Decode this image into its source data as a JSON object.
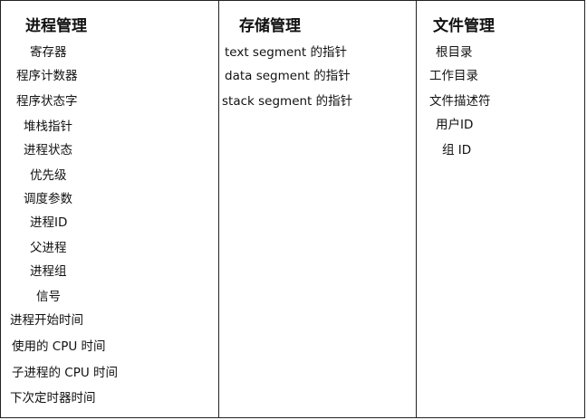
{
  "columns": [
    {
      "header": "进程管理",
      "items": [
        "寄存器",
        "程序计数器",
        "程序状态字",
        "堆栈指针",
        "进程状态",
        "优先级",
        "调度参数",
        "进程ID",
        "父进程",
        "进程组",
        "信号",
        "进程开始时间",
        "使用的 CPU 时间",
        "子进程的 CPU 时间",
        "下次定时器时间"
      ]
    },
    {
      "header": "存储管理",
      "items": [
        "text segment  的指针",
        "data segment 的指针",
        "stack segment 的指针"
      ]
    },
    {
      "header": "文件管理",
      "items": [
        "根目录",
        "工作目录",
        "文件描述符",
        "用户ID",
        "组 ID"
      ]
    }
  ]
}
